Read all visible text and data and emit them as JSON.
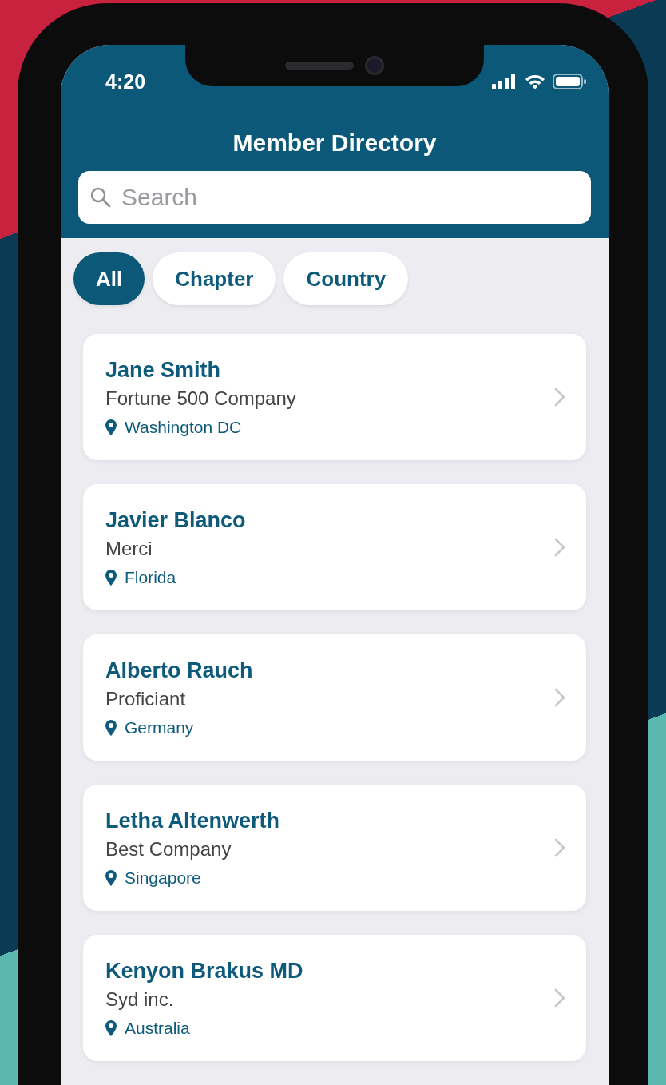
{
  "status_bar": {
    "time": "4:20"
  },
  "header": {
    "title": "Member Directory"
  },
  "search": {
    "placeholder": "Search"
  },
  "filters": [
    {
      "label": "All",
      "selected": true
    },
    {
      "label": "Chapter",
      "selected": false
    },
    {
      "label": "Country",
      "selected": false
    }
  ],
  "members": [
    {
      "name": "Jane Smith",
      "company": "Fortune 500 Company",
      "location": "Washington DC"
    },
    {
      "name": "Javier Blanco",
      "company": "Merci",
      "location": "Florida"
    },
    {
      "name": "Alberto Rauch",
      "company": "Proficiant",
      "location": "Germany"
    },
    {
      "name": "Letha Altenwerth",
      "company": "Best Company",
      "location": "Singapore"
    },
    {
      "name": "Kenyon Brakus MD",
      "company": "Syd inc.",
      "location": "Australia"
    }
  ]
}
